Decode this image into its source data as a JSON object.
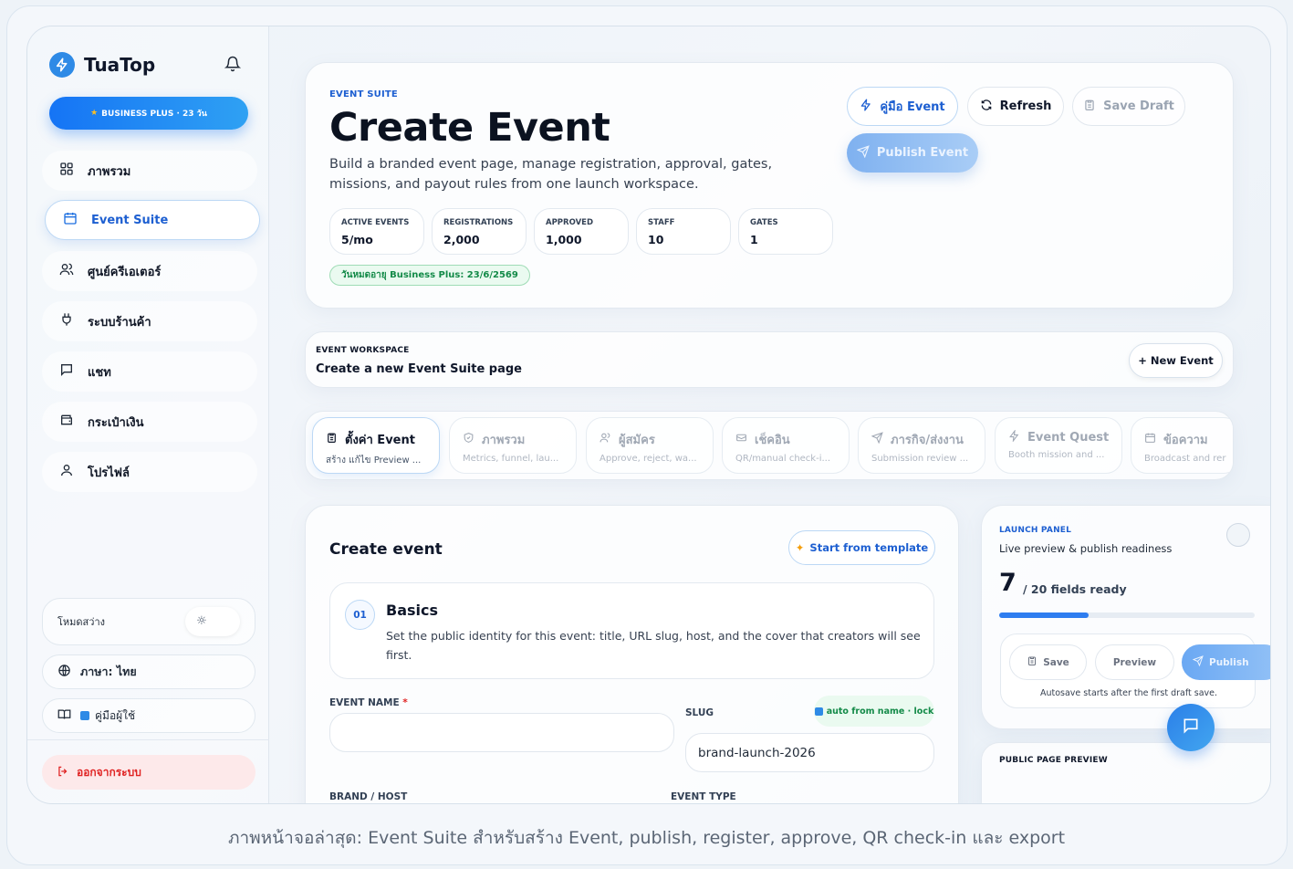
{
  "sidebar": {
    "brand": "TuaTop",
    "plan_badge": "BUSINESS PLUS · 23 วัน",
    "items": [
      {
        "label": "ภาพรวม",
        "icon": "grid-icon"
      },
      {
        "label": "Event Suite",
        "icon": "calendar-icon"
      },
      {
        "label": "ศูนย์ครีเอเตอร์",
        "icon": "users-icon"
      },
      {
        "label": "ระบบร้านค้า",
        "icon": "plug-icon"
      },
      {
        "label": "แชท",
        "icon": "chat-icon"
      },
      {
        "label": "กระเป๋าเงิน",
        "icon": "wallet-icon"
      },
      {
        "label": "โปรไฟล์",
        "icon": "user-icon"
      }
    ],
    "light_mode_label": "โหมดสว่าง",
    "language_label": "ภาษา: ไทย",
    "manual_label": "คู่มือผู้ใช้",
    "logout_label": "ออกจากระบบ"
  },
  "hero": {
    "eyebrow": "EVENT SUITE",
    "title": "Create Event",
    "description": "Build a branded event page, manage registration, approval, gates, missions, and payout rules from one launch workspace.",
    "stats": [
      {
        "label": "ACTIVE EVENTS",
        "value": "5/mo"
      },
      {
        "label": "REGISTRATIONS",
        "value": "2,000"
      },
      {
        "label": "APPROVED",
        "value": "1,000"
      },
      {
        "label": "STAFF",
        "value": "10"
      },
      {
        "label": "GATES",
        "value": "1"
      }
    ],
    "expiry": "วันหมดอายุ Business Plus: 23/6/2569",
    "buttons": {
      "guide": "คู่มือ Event",
      "refresh": "Refresh",
      "save_draft": "Save Draft",
      "publish": "Publish Event"
    }
  },
  "workspace": {
    "eyebrow": "EVENT WORKSPACE",
    "title": "Create a new Event Suite page",
    "new_event": "+ New Event"
  },
  "tabs": [
    {
      "title": "ตั้งค่า Event",
      "sub": "สร้าง แก้ไข Preview ...",
      "icon": "clipboard-icon"
    },
    {
      "title": "ภาพรวม",
      "sub": "Metrics, funnel, lau...",
      "icon": "shield-icon"
    },
    {
      "title": "ผู้สมัคร",
      "sub": "Approve, reject, wa...",
      "icon": "users-icon"
    },
    {
      "title": "เช็คอิน",
      "sub": "QR/manual check-i...",
      "icon": "ticket-icon"
    },
    {
      "title": "ภารกิจ/ส่งงาน",
      "sub": "Submission review ...",
      "icon": "send-icon"
    },
    {
      "title": "Event Quest",
      "sub": "Booth mission and ...",
      "icon": "bolt-icon"
    },
    {
      "title": "ข้อความ",
      "sub": "Broadcast and rer",
      "icon": "calendar-icon"
    }
  ],
  "form": {
    "title": "Create event",
    "template_button": "Start from template",
    "step": {
      "number": "01",
      "title": "Basics",
      "description": "Set the public identity for this event: title, URL slug, host, and the cover that creators will see first."
    },
    "event_name_label": "EVENT NAME",
    "required_mark": "*",
    "event_name_value": "",
    "slug_label": "SLUG",
    "slug_pill": "auto from name · lock",
    "slug_value": "brand-launch-2026",
    "brand_label": "BRAND / HOST",
    "type_label": "EVENT TYPE"
  },
  "launch_panel": {
    "eyebrow": "LAUNCH PANEL",
    "subtitle": "Live preview & publish readiness",
    "ready_count": "7",
    "ready_total": "/ 20 fields ready",
    "progress": 0.35,
    "save": "Save",
    "preview": "Preview",
    "publish": "Publish",
    "autosave_note": "Autosave starts after the first draft save.",
    "public_preview_label": "PUBLIC PAGE PREVIEW"
  },
  "caption": "ภาพหน้าจอล่าสุด: Event Suite สำหรับสร้าง Event, publish, register, approve, QR check-in และ export",
  "colors": {
    "accent": "#1d5fd1",
    "brand_blue": "#2e8ae6",
    "success": "#138a48",
    "danger": "#e02424"
  }
}
